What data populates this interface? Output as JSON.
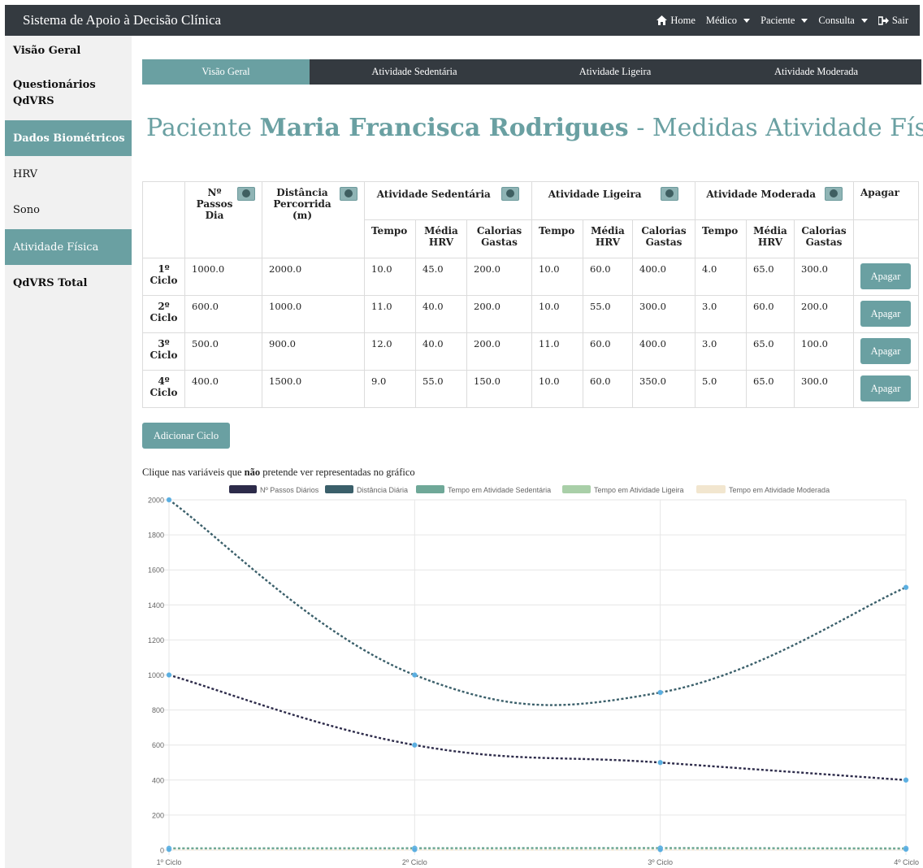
{
  "navbar": {
    "brand": "Sistema de Apoio à Decisão Clínica",
    "links": [
      "Home",
      "Médico",
      "Paciente",
      "Consulta",
      "Sair"
    ]
  },
  "sidebar": {
    "items": [
      "Visão Geral",
      "Questionários QdVRS",
      "Dados Biométricos",
      "HRV",
      "Sono",
      "Atividade Física",
      "QdVRS Total"
    ]
  },
  "tabs": [
    "Visão Geral",
    "Atividade Sedentária",
    "Atividade Ligeira",
    "Atividade Moderada"
  ],
  "heading": {
    "prefix": "Paciente ",
    "patient": "Maria Francisca Rodrigues",
    "suffix": " - Medidas Atividade Física"
  },
  "table": {
    "headers": {
      "passos": "Nº Passos Dia",
      "distancia": "Distância Percorrida (m)",
      "sedentaria": "Atividade Sedentária",
      "ligeira": "Atividade Ligeira",
      "moderada": "Atividade Moderada",
      "apagar": "Apagar",
      "tempo": "Tempo",
      "media_hrv": "Média HRV",
      "calorias": "Calorias Gastas"
    },
    "rows": [
      {
        "ciclo": "1º Ciclo",
        "passos": "1000.0",
        "distancia": "2000.0",
        "sed": [
          "10.0",
          "45.0",
          "200.0"
        ],
        "lig": [
          "10.0",
          "60.0",
          "400.0"
        ],
        "mod": [
          "4.0",
          "65.0",
          "300.0"
        ]
      },
      {
        "ciclo": "2º Ciclo",
        "passos": "600.0",
        "distancia": "1000.0",
        "sed": [
          "11.0",
          "40.0",
          "200.0"
        ],
        "lig": [
          "10.0",
          "55.0",
          "300.0"
        ],
        "mod": [
          "3.0",
          "60.0",
          "200.0"
        ]
      },
      {
        "ciclo": "3º Ciclo",
        "passos": "500.0",
        "distancia": "900.0",
        "sed": [
          "12.0",
          "40.0",
          "200.0"
        ],
        "lig": [
          "11.0",
          "60.0",
          "400.0"
        ],
        "mod": [
          "3.0",
          "65.0",
          "100.0"
        ]
      },
      {
        "ciclo": "4º Ciclo",
        "passos": "400.0",
        "distancia": "1500.0",
        "sed": [
          "9.0",
          "55.0",
          "150.0"
        ],
        "lig": [
          "10.0",
          "60.0",
          "350.0"
        ],
        "mod": [
          "5.0",
          "65.0",
          "300.0"
        ]
      }
    ],
    "delete_label": "Apagar"
  },
  "add_cycle_label": "Adicionar Ciclo",
  "hint": {
    "before": "Clique nas variáveis que ",
    "bold": "não",
    "after": " pretende ver representadas no gráfico"
  },
  "chart_data": {
    "type": "line",
    "categories": [
      "1º Ciclo",
      "2º Ciclo",
      "3º Ciclo",
      "4º Ciclo"
    ],
    "ylim": [
      0,
      2000
    ],
    "yticks": [
      "0",
      "200",
      "400",
      "600",
      "800",
      "1000",
      "1200",
      "1400",
      "1600",
      "1800",
      "2000"
    ],
    "grid": true,
    "legend_position": "top",
    "series": [
      {
        "name": "Nº Passos Diários",
        "values": [
          1000,
          600,
          500,
          400
        ],
        "color": "#2d2b4a"
      },
      {
        "name": "Distância Diária",
        "values": [
          2000,
          1000,
          900,
          1500
        ],
        "color": "#3a5f6a"
      },
      {
        "name": "Tempo em Atividade Sedentária",
        "values": [
          10,
          11,
          12,
          9
        ],
        "color": "#6fa898"
      },
      {
        "name": "Tempo em Atividade Ligeira",
        "values": [
          10,
          10,
          11,
          10
        ],
        "color": "#a9cfa8"
      },
      {
        "name": "Tempo em Atividade Moderada",
        "values": [
          4,
          3,
          3,
          5
        ],
        "color": "#f2e6cf"
      }
    ],
    "point_color": "#5aaee0"
  }
}
